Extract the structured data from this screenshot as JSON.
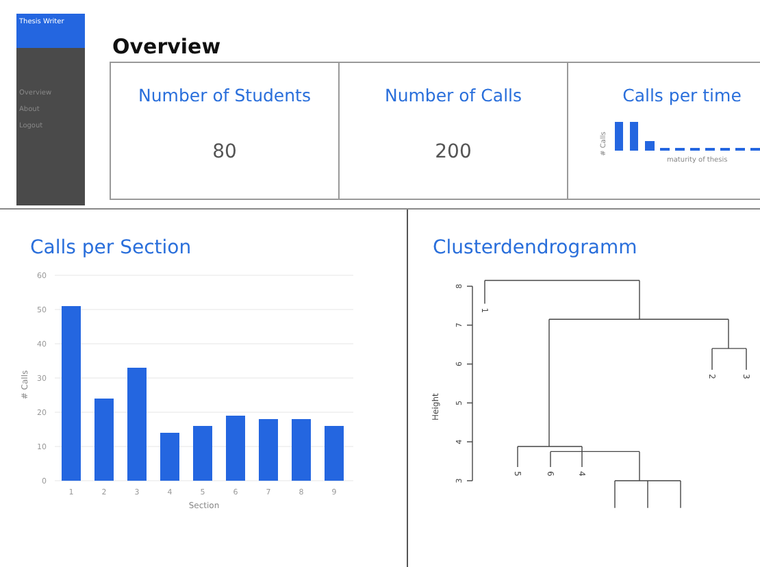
{
  "sidebar": {
    "title": "Thesis Writer",
    "items": [
      {
        "label": "Overview"
      },
      {
        "label": "About"
      },
      {
        "label": "Logout"
      }
    ]
  },
  "overview": {
    "title": "Overview",
    "cards": [
      {
        "kind": "stat",
        "title": "Number of Students",
        "value": "80"
      },
      {
        "kind": "stat",
        "title": "Number of Calls",
        "value": "200"
      },
      {
        "kind": "sparkline",
        "title": "Calls per time",
        "ylabel": "# Calls",
        "xlabel": "maturity of thesis"
      }
    ]
  },
  "calls_per_section": {
    "title": "Calls per Section",
    "chart_data": {
      "type": "bar",
      "xlabel": "Section",
      "ylabel": "# Calls",
      "categories": [
        "1",
        "2",
        "3",
        "4",
        "5",
        "6",
        "7",
        "8",
        "9"
      ],
      "values": [
        51,
        24,
        33,
        14,
        16,
        19,
        18,
        18,
        16
      ],
      "ylim": [
        0,
        60
      ],
      "grid": true,
      "yticks": [
        0,
        10,
        20,
        30,
        40,
        50,
        60
      ]
    }
  },
  "dendrogram": {
    "title": "Clusterdendrogramm",
    "ylabel": "Height",
    "yticks": [
      "3",
      "4",
      "5",
      "6",
      "7",
      "8"
    ],
    "leaves": [
      "1",
      "5",
      "6",
      "4",
      "2",
      "3"
    ]
  }
}
